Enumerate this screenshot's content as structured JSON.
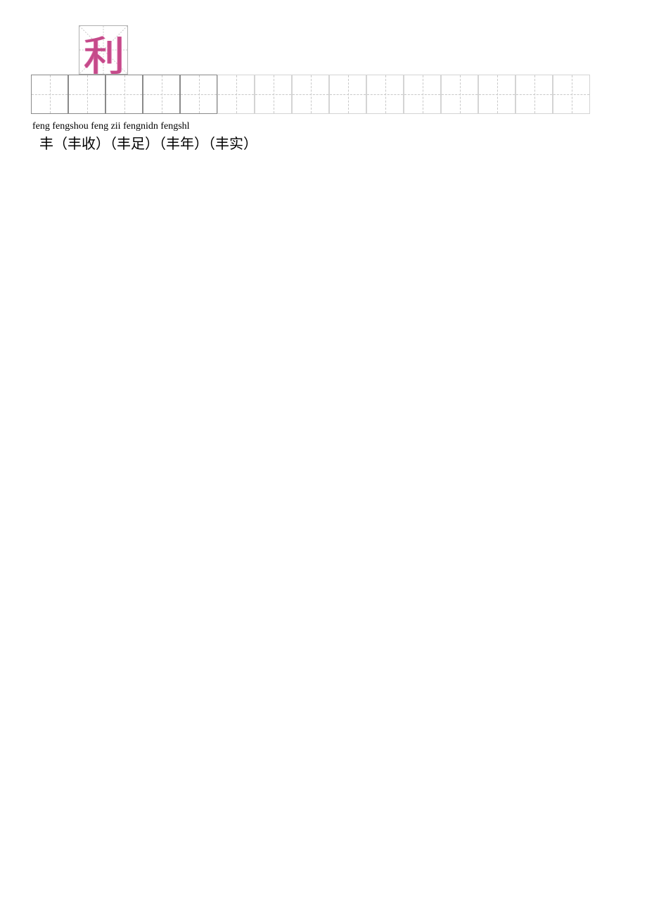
{
  "example_char": "利",
  "grid": {
    "solid_cells": 5,
    "light_cells": 10,
    "total_cells": 15
  },
  "pinyin_line": "feng fengshou feng zii fengnidn fengshl",
  "hanzi_line": "丰（丰收）（丰足）（丰年）（丰实）"
}
